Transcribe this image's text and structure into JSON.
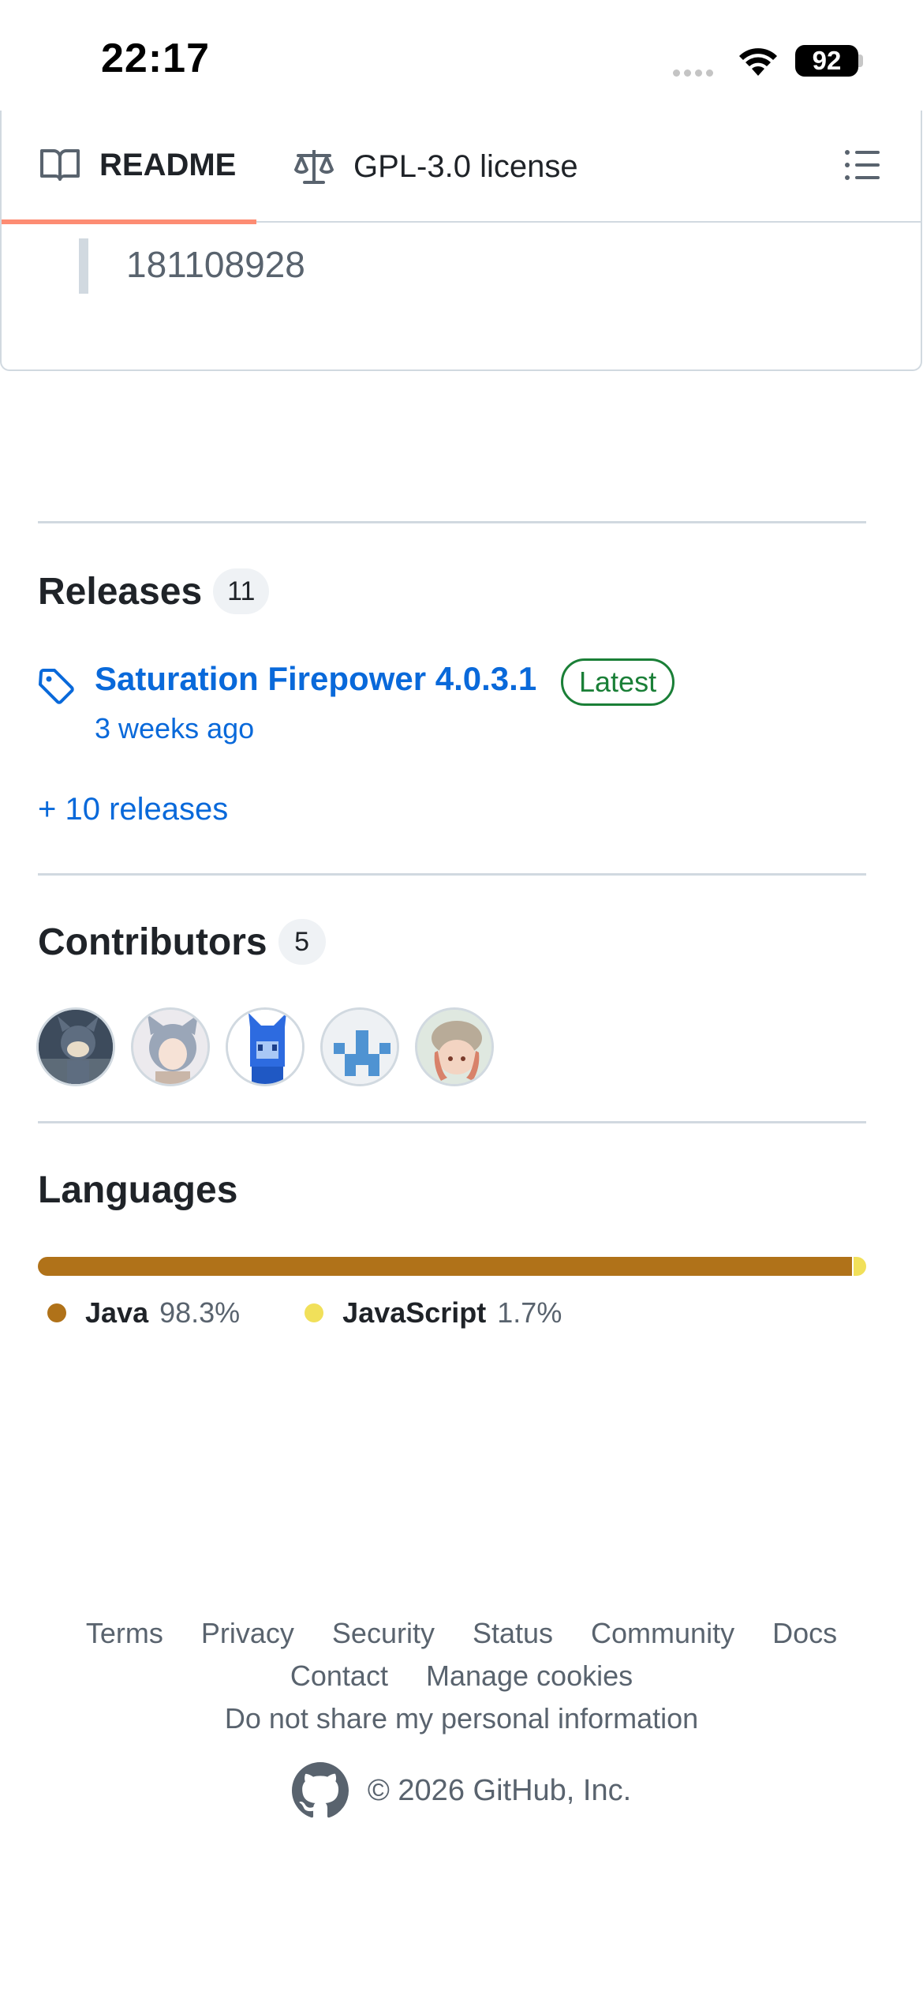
{
  "status_bar": {
    "time": "22:17",
    "battery": "92"
  },
  "readme_tabs": {
    "readme_label": "README",
    "license_label": "GPL-3.0 license"
  },
  "readme_quote": "181108928",
  "releases": {
    "title": "Releases",
    "count": "11",
    "latest_name": "Saturation Firepower 4.0.3.1",
    "latest_badge": "Latest",
    "latest_date": "3 weeks ago",
    "more_link": "+ 10 releases"
  },
  "contributors": {
    "title": "Contributors",
    "count": "5",
    "avatars": [
      "contributor-1",
      "contributor-2",
      "contributor-3",
      "contributor-4",
      "contributor-5"
    ]
  },
  "languages": {
    "title": "Languages",
    "items": [
      {
        "name": "Java",
        "percent": "98.3%",
        "value": 98.3,
        "color": "#b07219"
      },
      {
        "name": "JavaScript",
        "percent": "1.7%",
        "value": 1.7,
        "color": "#f1e05a"
      }
    ]
  },
  "footer": {
    "links_row1": [
      "Terms",
      "Privacy",
      "Security",
      "Status",
      "Community",
      "Docs"
    ],
    "links_row2": [
      "Contact",
      "Manage cookies"
    ],
    "links_row3": [
      "Do not share my personal information"
    ],
    "copyright": "© 2026 GitHub, Inc."
  },
  "colors": {
    "link": "#0969da",
    "success": "#1a7f37",
    "tab_underline": "#fd8c73"
  }
}
